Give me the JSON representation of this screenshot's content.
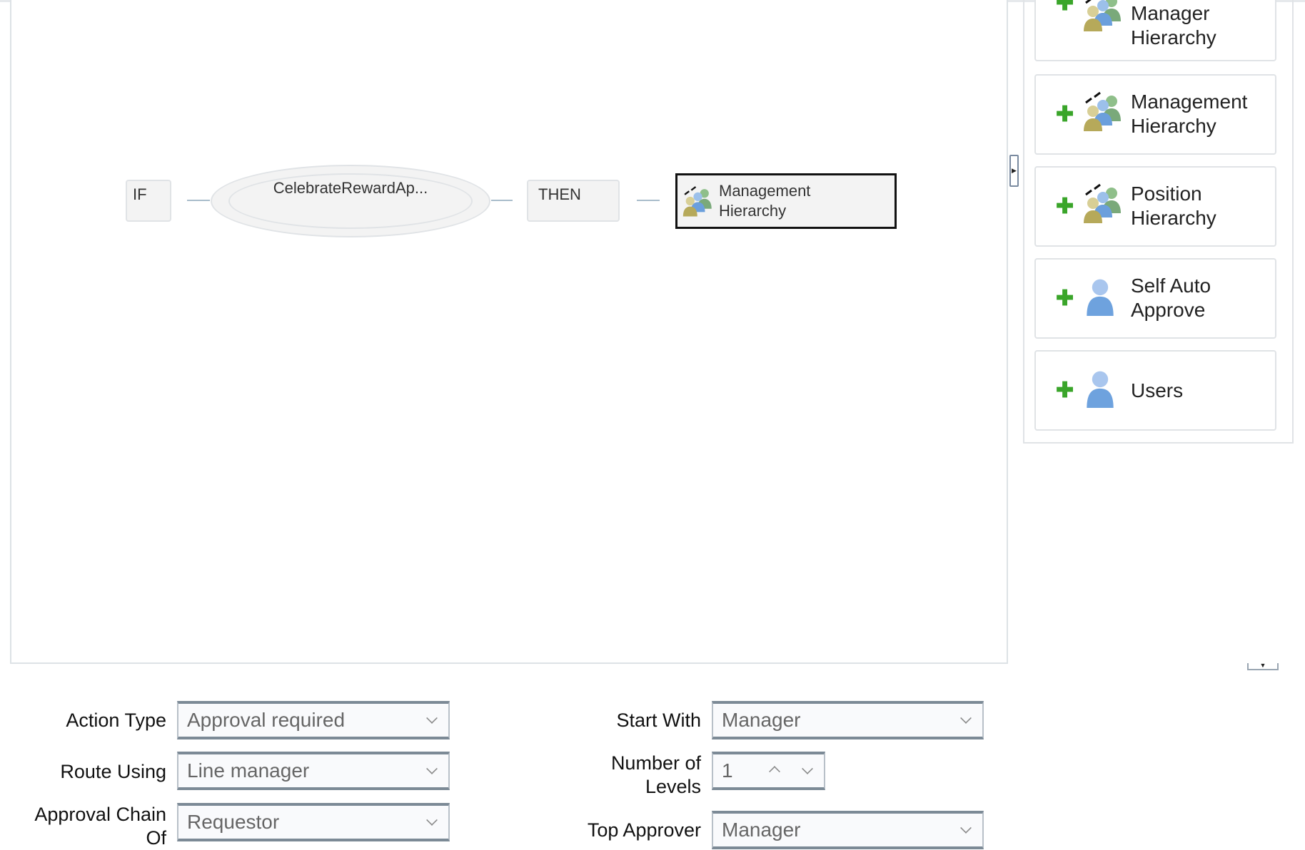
{
  "diagram": {
    "if_label": "IF",
    "condition_label": "CelebrateRewardAp...",
    "then_label": "THEN",
    "action_label": "Management Hierarchy"
  },
  "palette": {
    "items": [
      {
        "label": "Manager Hierarchy",
        "icon": "group-hierarchy-icon"
      },
      {
        "label": "Management Hierarchy",
        "icon": "group-hierarchy-icon"
      },
      {
        "label": "Position Hierarchy",
        "icon": "group-hierarchy-icon"
      },
      {
        "label": "Self Auto Approve",
        "icon": "user-icon"
      },
      {
        "label": "Users",
        "icon": "user-icon"
      }
    ]
  },
  "form": {
    "action_type": {
      "label": "Action Type",
      "value": "Approval required"
    },
    "route_using": {
      "label": "Route Using",
      "value": "Line manager"
    },
    "approval_chain_of": {
      "label": "Approval Chain Of",
      "value": "Requestor"
    },
    "start_with": {
      "label": "Start With",
      "value": "Manager"
    },
    "number_of_levels": {
      "label": "Number of Levels",
      "value": "1"
    },
    "top_approver": {
      "label": "Top Approver",
      "value": "Manager"
    }
  },
  "colors": {
    "add_green": "#3aa52a",
    "selected_border": "#111111",
    "connector": "#a9bccb"
  }
}
